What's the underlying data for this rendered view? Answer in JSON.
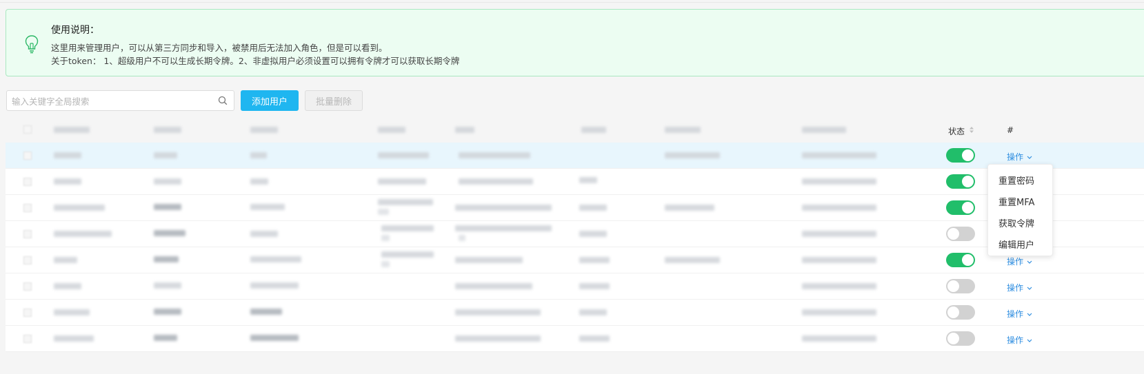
{
  "notice": {
    "title": "使用说明：",
    "line1": "这里用来管理用户，可以从第三方同步和导入，被禁用后无法加入角色，但是可以看到。",
    "line2": "关于token： 1、超级用户不可以生成长期令牌。2、非虚拟用户必须设置可以拥有令牌才可以获取长期令牌",
    "icon": "lightbulb-icon",
    "colors": {
      "background": "#ecfdf2",
      "border": "#a9e8c0"
    }
  },
  "toolbar": {
    "search_placeholder": "输入关键字全局搜索",
    "add_label": "添加用户",
    "batch_delete_label": "批量删除",
    "colors": {
      "primary": "#1fb6f0"
    }
  },
  "table": {
    "status_header": "状态",
    "action_header": "#",
    "rows": [
      {
        "status_on": true,
        "action_label": "操作"
      },
      {
        "status_on": true,
        "action_label": "操作"
      },
      {
        "status_on": true,
        "action_label": "操作"
      },
      {
        "status_on": false,
        "action_label": "操作"
      },
      {
        "status_on": true,
        "action_label": "操作"
      },
      {
        "status_on": false,
        "action_label": "操作"
      },
      {
        "status_on": false,
        "action_label": "操作"
      },
      {
        "status_on": false,
        "action_label": "操作"
      }
    ],
    "colors": {
      "toggle_on": "#21be6a",
      "toggle_off": "#d2d2d2",
      "link": "#2f8ee0"
    }
  },
  "dropdown": {
    "items": [
      "重置密码",
      "重置MFA",
      "获取令牌",
      "编辑用户"
    ]
  }
}
